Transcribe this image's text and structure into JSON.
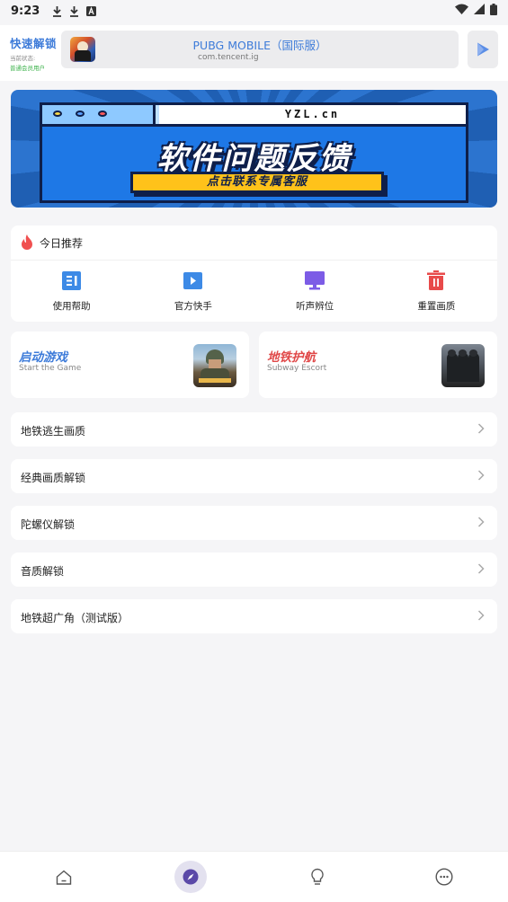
{
  "status_bar": {
    "time": "9:23",
    "icons": [
      "download-icon",
      "download-icon",
      "a-icon"
    ],
    "right_icons": [
      "wifi-icon",
      "signal-icon",
      "battery-icon"
    ]
  },
  "header": {
    "quick_unlock": {
      "title": "快速解锁",
      "state_line": "当前状态:",
      "user_line": "普通会员用户"
    },
    "app": {
      "name": "PUBG MOBILE（国际服）",
      "package": "com.tencent.ig",
      "icon": "pubg-app-icon"
    },
    "launch_icon": "play-icon"
  },
  "banner": {
    "url": "YZL.cn",
    "title": "软件问题反馈",
    "button": "点击联系专属客服"
  },
  "recommend": {
    "title": "今日推荐",
    "icon": "flame-icon",
    "items": [
      {
        "label": "使用帮助",
        "icon": "document-icon",
        "color": "#3d8ae6"
      },
      {
        "label": "官方快手",
        "icon": "video-icon",
        "color": "#3d8ae6"
      },
      {
        "label": "听声辨位",
        "icon": "monitor-icon",
        "color": "#7c5ce6"
      },
      {
        "label": "重置画质",
        "icon": "trash-icon",
        "color": "#e84a4a"
      }
    ]
  },
  "games": [
    {
      "title": "启动游戏",
      "subtitle": "Start the Game",
      "color": "#3d7bd9",
      "thumb": "pubg-thumbnail"
    },
    {
      "title": "地铁护航",
      "subtitle": "Subway Escort",
      "color": "#e04848",
      "thumb": "metro-thumbnail"
    }
  ],
  "menu": [
    {
      "label": "地铁逃生画质"
    },
    {
      "label": "经典画质解锁"
    },
    {
      "label": "陀螺仪解锁"
    },
    {
      "label": "音质解锁"
    },
    {
      "label": "地铁超广角（测试版）"
    }
  ],
  "bottom_nav": [
    {
      "icon": "home-icon",
      "active": false
    },
    {
      "icon": "compass-icon",
      "active": true
    },
    {
      "icon": "lightbulb-icon",
      "active": false
    },
    {
      "icon": "more-icon",
      "active": false
    }
  ]
}
